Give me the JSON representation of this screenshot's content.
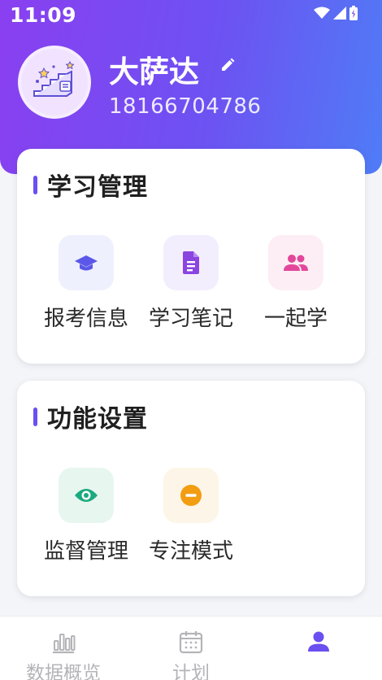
{
  "status_bar": {
    "time": "11:09"
  },
  "profile": {
    "name": "大萨达",
    "phone": "18166704786"
  },
  "sections": {
    "study": {
      "title": "学习管理",
      "items": [
        {
          "label": "报考信息",
          "icon": "graduation-cap-icon",
          "bg": "#eef0fd",
          "color": "#5b57e8"
        },
        {
          "label": "学习笔记",
          "icon": "document-icon",
          "bg": "#f3eefd",
          "color": "#8a44e0"
        },
        {
          "label": "一起学",
          "icon": "people-icon",
          "bg": "#fdeef5",
          "color": "#e2479a"
        }
      ]
    },
    "function": {
      "title": "功能设置",
      "items": [
        {
          "label": "监督管理",
          "icon": "eye-icon",
          "bg": "#e8f6f0",
          "color": "#1aaa7e"
        },
        {
          "label": "专注模式",
          "icon": "minus-circle-icon",
          "bg": "#fdf6e8",
          "color": "#f29d12"
        }
      ]
    }
  },
  "bottom_nav": {
    "items": [
      {
        "label": "数据概览",
        "icon": "bar-chart-icon"
      },
      {
        "label": "计划",
        "icon": "calendar-icon"
      },
      {
        "label": "",
        "icon": "user-icon",
        "active": true
      }
    ],
    "active_color": "#6b4ff0",
    "inactive_color": "#b4b4b8"
  }
}
